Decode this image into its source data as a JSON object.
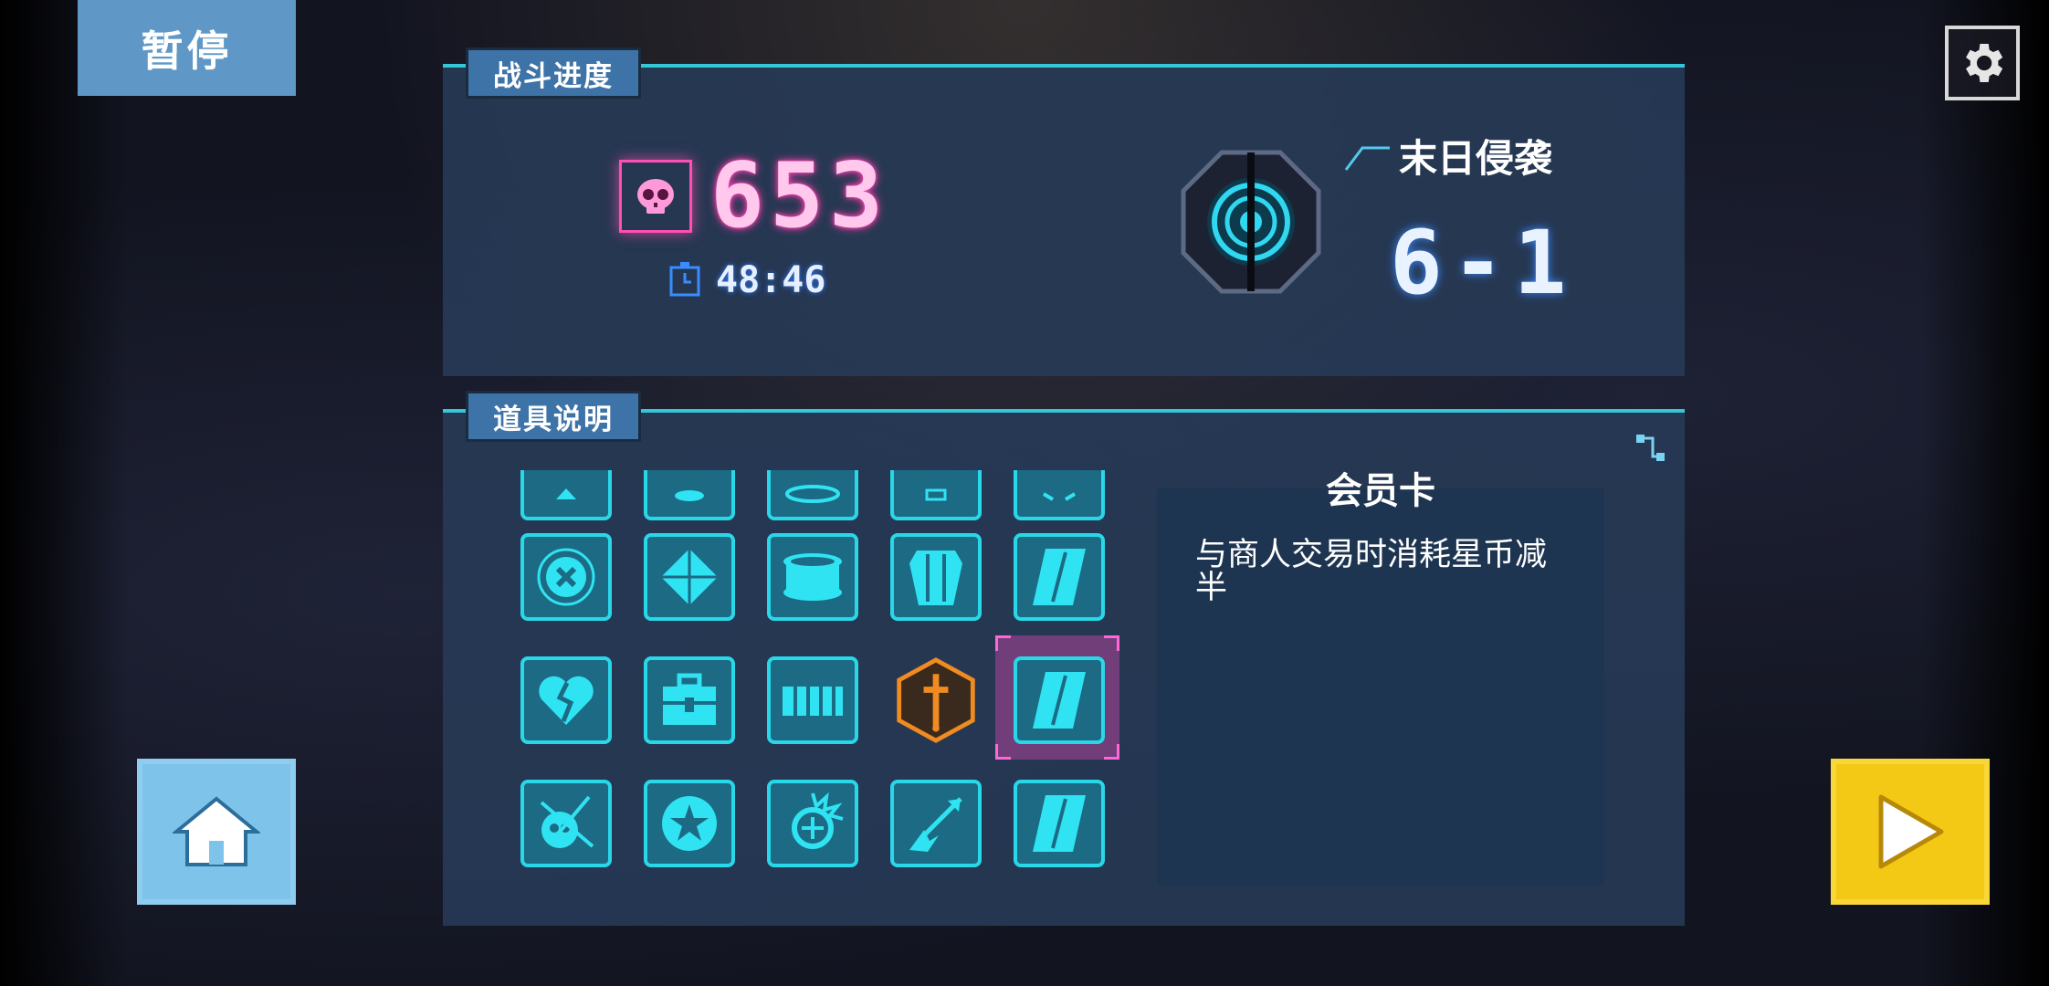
{
  "pause_label": "暂停",
  "battle": {
    "tab_label": "战斗进度",
    "kill_count": "653",
    "time": "48:46",
    "mode_name": "末日侵袭",
    "stage": "6-1"
  },
  "items": {
    "tab_label": "道具说明",
    "rows": [
      [
        "partial-item-icon",
        "partial-item-icon",
        "partial-item-icon",
        "partial-item-icon",
        "partial-item-icon"
      ],
      [
        "shield-x-icon",
        "diamond-icon",
        "drum-icon",
        "crystal-icon",
        "card-icon"
      ],
      [
        "broken-heart-icon",
        "medkit-icon",
        "fence-icon",
        "sword-badge-icon",
        "member-card-icon"
      ],
      [
        "slash-skull-icon",
        "star-badge-icon",
        "spiked-target-icon",
        "arrow-burst-icon",
        "card-icon"
      ]
    ],
    "selected": "member-card-icon"
  },
  "description": {
    "title": "会员卡",
    "text": "与商人交易时消耗星币减半"
  },
  "colors": {
    "item_border": "#29d8e8",
    "kill_pink": "#ff4fb2",
    "play_yellow": "#f3c915",
    "home_blue": "#7ec3ea"
  }
}
